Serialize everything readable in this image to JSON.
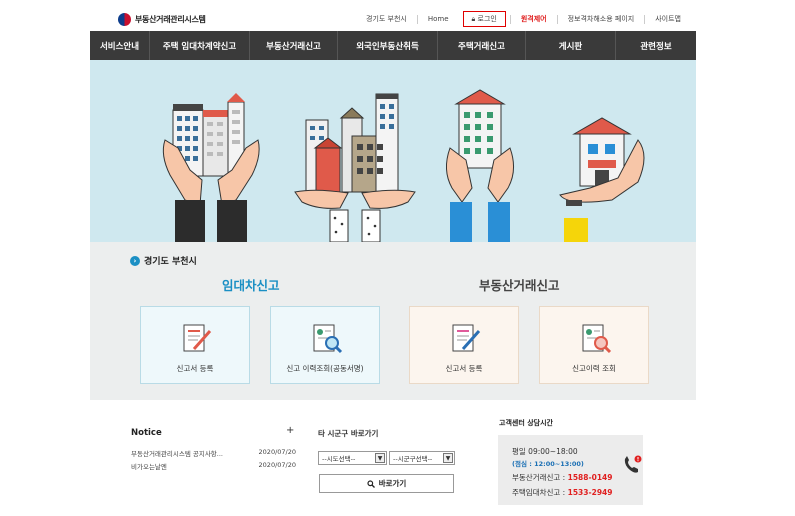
{
  "header": {
    "logo_text": "부동산거래관리시스템",
    "links": {
      "region": "경기도 부천시",
      "home": "Home",
      "login": "로그인",
      "remote": "원격제어",
      "accessibility": "정보격차해소용 페이지",
      "sitemap": "사이트맵"
    }
  },
  "nav": [
    "서비스안내",
    "주택 임대차계약신고",
    "부동산거래신고",
    "외국인부동산취득",
    "주택거래신고",
    "게시판",
    "관련정보"
  ],
  "panel": {
    "region": "경기도 부천시",
    "lease_title": "임대차신고",
    "realestate_title": "부동산거래신고",
    "cards": {
      "lease_register": "신고서 등록",
      "lease_history": "신고 이력조회(공동서명)",
      "real_register": "신고서 등록",
      "real_history": "신고이력 조회"
    }
  },
  "notice": {
    "title": "Notice",
    "plus": "+",
    "items": [
      {
        "title": "부동산거래관리시스템 공지사항...",
        "date": "2020/07/20"
      },
      {
        "title": "비가오는날엔",
        "date": "2020/07/20"
      }
    ]
  },
  "shortcut": {
    "title": "타 시군구 바로가기",
    "sido_select": "--시도선택--",
    "sigungu_select": "--시군구선택--",
    "go_button": "바로가기"
  },
  "customer_center": {
    "title": "고객센터 상담시간",
    "weekday": "평일  09:00~18:00",
    "lunch_label": "(점심 : ",
    "lunch_time": "12:00~13:00",
    "lunch_close": ")",
    "real_label": "부동산거래신고 : ",
    "real_phone": "1588-0149",
    "lease_label": "주택임대차신고 : ",
    "lease_phone": "1533-2949"
  },
  "colors": {
    "accent_blue": "#1a8fc4",
    "nav_bg": "#3a3a3a",
    "hero_bg": "#cfe8ef",
    "phone_red": "#e02020"
  }
}
